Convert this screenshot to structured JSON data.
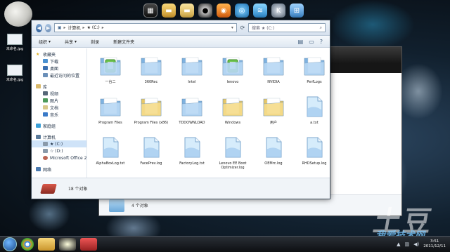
{
  "desktop": {
    "icons": [
      {
        "label": "未命名.jpg"
      },
      {
        "label": "未命名.jpg"
      }
    ],
    "dock": [
      "thumbnail-icon",
      "folder-icon",
      "folder-icon",
      "qq-icon",
      "app-icon",
      "network-icon",
      "layers-icon",
      "k-icon",
      "window-icon"
    ],
    "watermark_top": "土豆",
    "watermark_bottom": "我爱技术网"
  },
  "explorer": {
    "address": {
      "root": "计算机",
      "drive": "★ (C:)"
    },
    "search_placeholder": "搜索 ★ (C:)",
    "toolbar": {
      "organize": "组织",
      "share": "共享",
      "burn": "刻录",
      "new_folder": "新建文件夹"
    },
    "nav": {
      "favorites": "收藏夹",
      "favorites_items": [
        "下载",
        "桌面",
        "最近访问的位置"
      ],
      "libraries": "库",
      "library_items": [
        "视频",
        "图片",
        "文档",
        "音乐"
      ],
      "homegroup": "家庭组",
      "computer": "计算机",
      "computer_items": [
        "★ (C:)",
        "☆ (D:)",
        "Microsoft Office 2"
      ],
      "network": "网络"
    },
    "files": [
      {
        "name": "一台二",
        "kind": "folder-special"
      },
      {
        "name": "360Rec",
        "kind": "folder"
      },
      {
        "name": "Intel",
        "kind": "folder"
      },
      {
        "name": "lenovo",
        "kind": "folder-special"
      },
      {
        "name": "NVIDIA",
        "kind": "folder"
      },
      {
        "name": "PerfLogs",
        "kind": "folder"
      },
      {
        "name": "Program Files",
        "kind": "folder"
      },
      {
        "name": "Program Files (x86)",
        "kind": "folder-yellow"
      },
      {
        "name": "TDDOWNLOAD",
        "kind": "folder"
      },
      {
        "name": "Windows",
        "kind": "folder-yellow"
      },
      {
        "name": "用户",
        "kind": "folder-yellow"
      },
      {
        "name": "a.txt",
        "kind": "file"
      },
      {
        "name": "AlphaBoxLog.txt",
        "kind": "file"
      },
      {
        "name": "FacePrev.log",
        "kind": "file"
      },
      {
        "name": "FactoryLog.txt",
        "kind": "file"
      },
      {
        "name": "Lenovo EE Boot Optimizer.log",
        "kind": "file"
      },
      {
        "name": "OEMrc.log",
        "kind": "file"
      },
      {
        "name": "RHDSetup.log",
        "kind": "file"
      }
    ],
    "status_text": "18 个对象"
  },
  "back_window": {
    "status_text": "4 个对象"
  },
  "taskbar": {
    "apps": [
      "start",
      "chrome-icon",
      "folder-icon",
      "qq-icon",
      "media-icon"
    ],
    "time": "3:51",
    "date": "2011/12/11"
  }
}
